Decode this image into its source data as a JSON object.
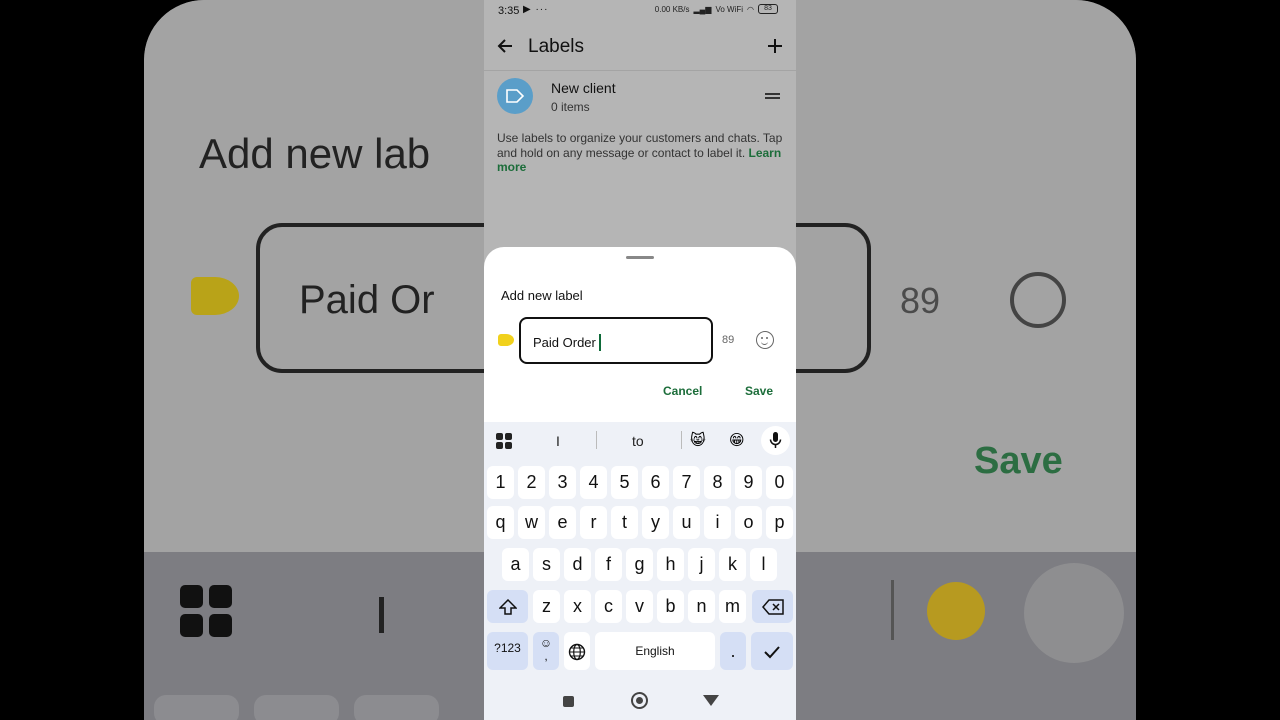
{
  "status_bar": {
    "time": "3:35",
    "notif_icons": "▶ ···",
    "net_speed": "0.00 KB/s",
    "network": "Vo WiFi",
    "battery": "83"
  },
  "app_bar": {
    "title": "Labels"
  },
  "labels_list": [
    {
      "name": "New client",
      "count": "0 items"
    }
  ],
  "help_text": "Use labels to organize your customers and chats. Tap and hold on any message or contact to label it.",
  "help_link": "Learn more",
  "dialog": {
    "title": "Add new label",
    "input_value": "Paid Order",
    "char_count": "89",
    "cancel_label": "Cancel",
    "save_label": "Save"
  },
  "keyboard": {
    "suggestions": [
      "I",
      "to"
    ],
    "emoji_suggestions": [
      "😸",
      "😁"
    ],
    "row_numbers": [
      "1",
      "2",
      "3",
      "4",
      "5",
      "6",
      "7",
      "8",
      "9",
      "0"
    ],
    "row_1": [
      "q",
      "w",
      "e",
      "r",
      "t",
      "y",
      "u",
      "i",
      "o",
      "p"
    ],
    "row_2": [
      "a",
      "s",
      "d",
      "f",
      "g",
      "h",
      "j",
      "k",
      "l"
    ],
    "row_3": [
      "z",
      "x",
      "c",
      "v",
      "b",
      "n",
      "m"
    ],
    "symbols_label": "?123",
    "emoji_comma_label": "☺\n,",
    "space_label": "English",
    "period_label": "."
  },
  "background": {
    "title": "Add new lab",
    "field_text": "Paid Or",
    "count": "89",
    "save": "Save"
  },
  "colors": {
    "accent": "#1c6d3a",
    "label_avatar": "#5a9ec9",
    "tag": "#f1d11c",
    "key_func": "#d5dff5"
  }
}
